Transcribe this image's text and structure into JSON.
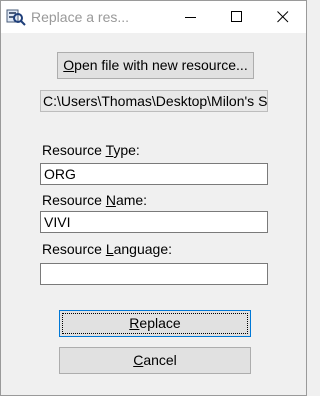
{
  "window": {
    "title": "Replace a res..."
  },
  "buttons": {
    "open_file": {
      "pre": "",
      "key": "O",
      "post": "pen file with new resource..."
    },
    "replace": {
      "pre": "",
      "key": "R",
      "post": "eplace"
    },
    "cancel": {
      "pre": "",
      "key": "C",
      "post": "ancel"
    }
  },
  "path": {
    "value": "C:\\Users\\Thomas\\Desktop\\Milon's S"
  },
  "fields": {
    "type": {
      "label_pre": "Resource ",
      "label_key": "T",
      "label_post": "ype:",
      "value": "ORG"
    },
    "name": {
      "label_pre": "Resource ",
      "label_key": "N",
      "label_post": "ame:",
      "value": "VIVI"
    },
    "language": {
      "label_pre": "Resource ",
      "label_key": "L",
      "label_post": "anguage:",
      "value": ""
    }
  }
}
